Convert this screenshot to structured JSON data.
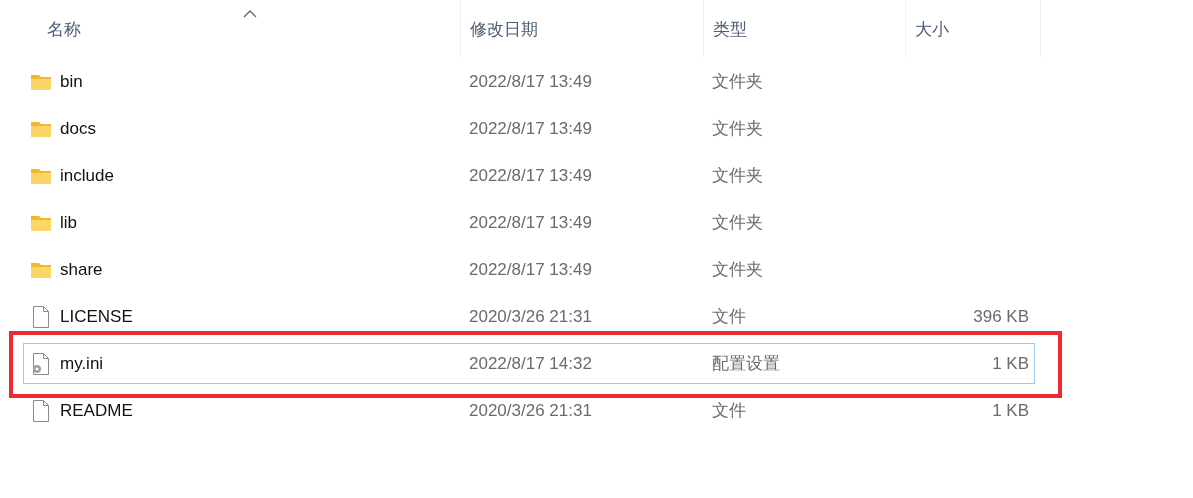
{
  "columns": [
    {
      "label": "名称",
      "sorted": true
    },
    {
      "label": "修改日期",
      "sorted": false
    },
    {
      "label": "类型",
      "sorted": false
    },
    {
      "label": "大小",
      "sorted": false
    }
  ],
  "files": [
    {
      "kind": "folder",
      "name": "bin",
      "modified": "2022/8/17 13:49",
      "type": "文件夹",
      "selected": false,
      "highlighted": false
    },
    {
      "kind": "folder",
      "name": "docs",
      "modified": "2022/8/17 13:49",
      "type": "文件夹",
      "selected": false,
      "highlighted": false
    },
    {
      "kind": "folder",
      "name": "include",
      "modified": "2022/8/17 13:49",
      "type": "文件夹",
      "selected": false,
      "highlighted": false
    },
    {
      "kind": "folder",
      "name": "lib",
      "modified": "2022/8/17 13:49",
      "type": "文件夹",
      "selected": false,
      "highlighted": false
    },
    {
      "kind": "folder",
      "name": "share",
      "modified": "2022/8/17 13:49",
      "type": "文件夹",
      "selected": false,
      "highlighted": false
    },
    {
      "kind": "file",
      "name": "LICENSE",
      "modified": "2020/3/26 21:31",
      "type": "文件",
      "size": "396 KB",
      "selected": false,
      "highlighted": false
    },
    {
      "kind": "config",
      "name": "my.ini",
      "modified": "2022/8/17 14:32",
      "type": "配置设置",
      "size": "1 KB",
      "selected": true,
      "highlighted": true
    },
    {
      "kind": "file",
      "name": "README",
      "modified": "2020/3/26 21:31",
      "type": "文件",
      "size": "1 KB",
      "selected": false,
      "highlighted": false
    }
  ]
}
